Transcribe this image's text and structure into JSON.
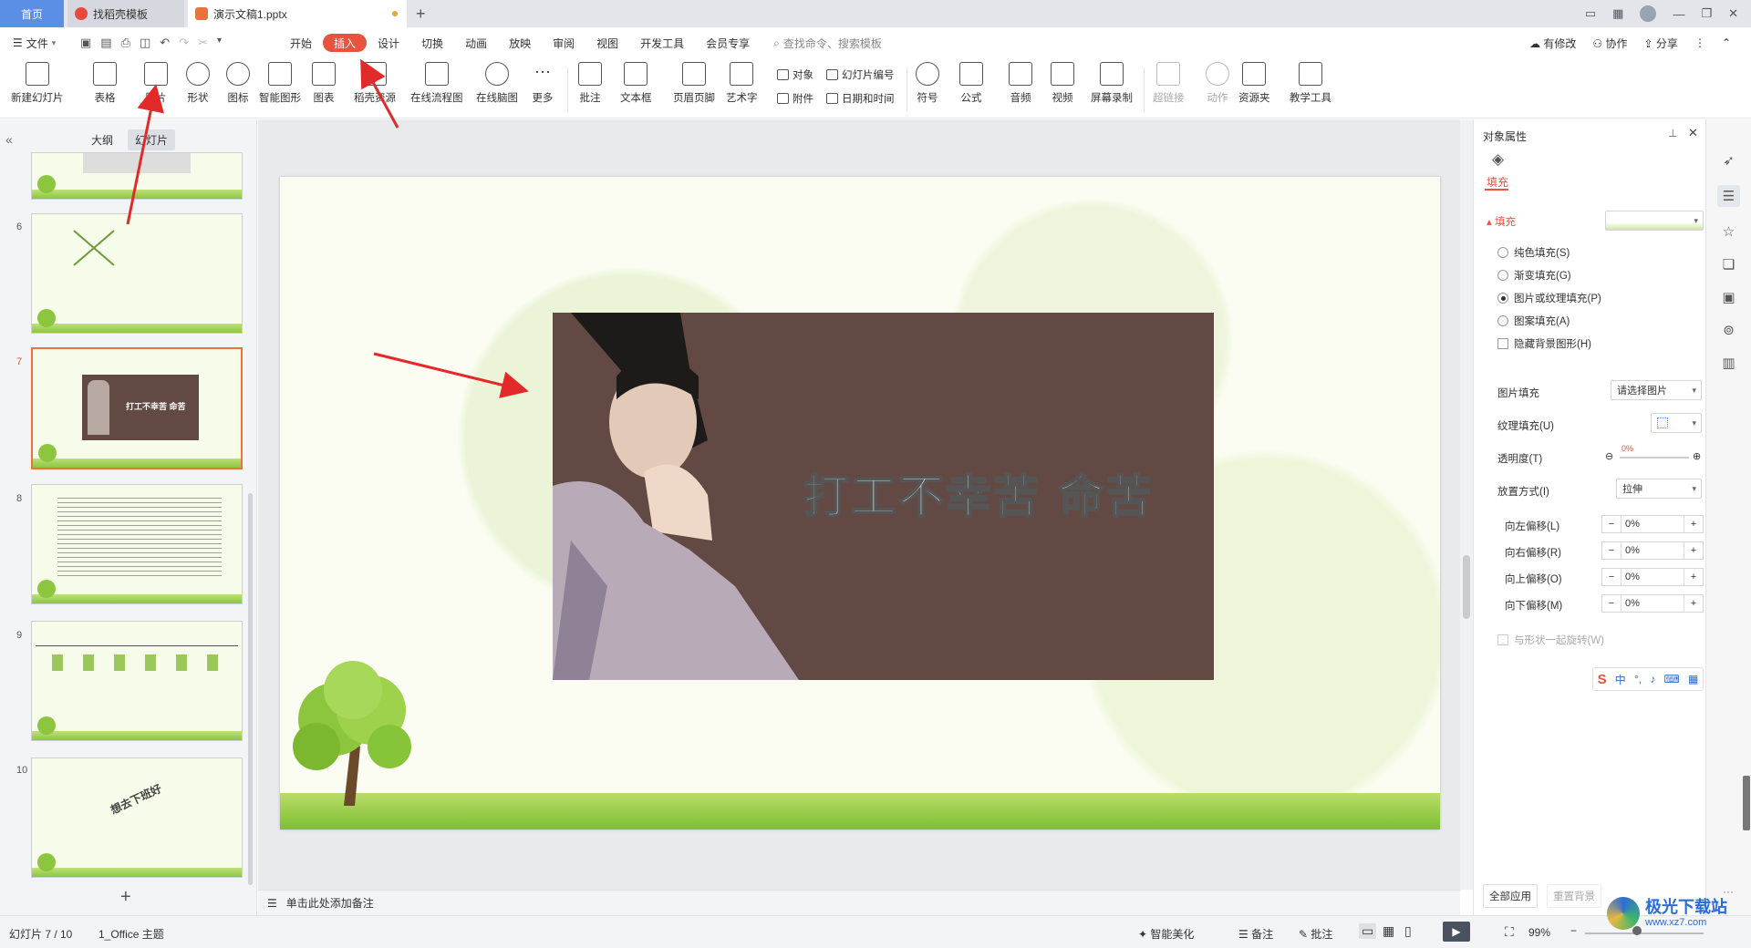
{
  "titlebar": {
    "home_tab": "首页",
    "template_tab": "找稻壳模板",
    "doc_tab": "演示文稿1.pptx",
    "new_tab": "+"
  },
  "menu": {
    "file": "文件",
    "items": [
      "开始",
      "插入",
      "设计",
      "切换",
      "动画",
      "放映",
      "审阅",
      "视图",
      "开发工具",
      "会员专享"
    ],
    "active": "插入",
    "search_placeholder": "查找命令、搜索模板",
    "right": {
      "changes": "有修改",
      "collab": "协作",
      "share": "分享"
    }
  },
  "ribbon": {
    "buttons": [
      "新建幻灯片",
      "表格",
      "图片",
      "形状",
      "图标",
      "智能图形",
      "图表",
      "稻壳资源",
      "在线流程图",
      "在线脑图",
      "更多",
      "批注",
      "文本框",
      "页眉页脚",
      "艺术字"
    ],
    "small": {
      "object": "对象",
      "slide_number": "幻灯片编号",
      "attach": "附件",
      "datetime": "日期和时间"
    },
    "buttons2": [
      "符号",
      "公式",
      "音频",
      "视频",
      "屏幕录制",
      "超链接",
      "动作",
      "资源夹",
      "教学工具"
    ]
  },
  "leftpanel": {
    "tab_outline": "大纲",
    "tab_slides": "幻灯片",
    "slide_numbers": [
      "6",
      "7",
      "8",
      "9",
      "10"
    ],
    "thumb10_text": "想去下班好",
    "add": "+"
  },
  "slide": {
    "caption": "打工不幸苦 命苦"
  },
  "notes": {
    "placeholder": "单击此处添加备注"
  },
  "rightpanel": {
    "title": "对象属性",
    "tab": "填充",
    "section": "填充",
    "radios": [
      "纯色填充(S)",
      "渐变填充(G)",
      "图片或纹理填充(P)",
      "图案填充(A)"
    ],
    "selected_radio": "图片或纹理填充(P)",
    "hide_bg": "隐藏背景图形(H)",
    "pic_fill_label": "图片填充",
    "pic_fill_value": "请选择图片",
    "texture_label": "纹理填充(U)",
    "transparency_label": "透明度(T)",
    "transparency_value": "0%",
    "placement_label": "放置方式(I)",
    "placement_value": "拉伸",
    "offsets": [
      {
        "label": "向左偏移(L)",
        "value": "0%"
      },
      {
        "label": "向右偏移(R)",
        "value": "0%"
      },
      {
        "label": "向上偏移(O)",
        "value": "0%"
      },
      {
        "label": "向下偏移(M)",
        "value": "0%"
      }
    ],
    "rotate_with_shape": "与形状一起旋转(W)",
    "apply_all": "全部应用",
    "reset_bg": "重置背景"
  },
  "ime": {
    "lang": "中"
  },
  "status": {
    "slide_info": "幻灯片 7 / 10",
    "theme": "1_Office 主题",
    "beautify": "智能美化",
    "notes": "备注",
    "comments": "批注",
    "zoom": "99%"
  },
  "watermark": {
    "title": "极光下载站",
    "url": "www.xz7.com"
  },
  "colors": {
    "accent": "#e8533f",
    "home_tab": "#5b8fe6",
    "photo_bg": "#634943"
  }
}
